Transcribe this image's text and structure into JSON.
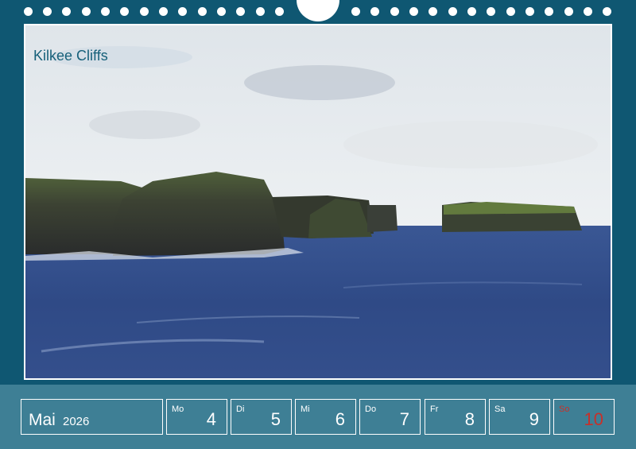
{
  "photo": {
    "title": "Kilkee Cliffs",
    "scene": "sea-cliffs-overcast"
  },
  "calendar": {
    "month": "Mai",
    "year": "2026",
    "days": [
      {
        "abbr": "Mo",
        "num": "4"
      },
      {
        "abbr": "Di",
        "num": "5"
      },
      {
        "abbr": "Mi",
        "num": "6"
      },
      {
        "abbr": "Do",
        "num": "7"
      },
      {
        "abbr": "Fr",
        "num": "8"
      },
      {
        "abbr": "Sa",
        "num": "9"
      },
      {
        "abbr": "So",
        "num": "10"
      }
    ]
  },
  "colors": {
    "background": "#0f5772",
    "band": "#3e7f95",
    "title": "#16607a",
    "sunday": "#c8302a"
  }
}
